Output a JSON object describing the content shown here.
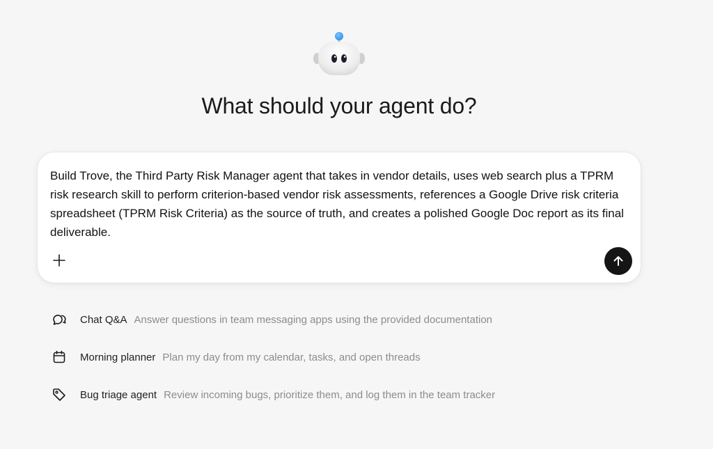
{
  "heading": "What should your agent do?",
  "composer": {
    "prompt": "Build Trove, the Third Party Risk Manager agent that takes in vendor details, uses web search plus a TPRM risk research skill to perform criterion-based vendor risk assessments, references a Google Drive risk criteria spreadsheet (TPRM Risk Criteria) as the source of truth, and creates a polished Google Doc report as its final deliverable.",
    "attach_icon": "plus-icon",
    "send_icon": "arrow-up-icon"
  },
  "suggestions": [
    {
      "icon": "chat-bubbles-icon",
      "title": "Chat Q&A",
      "description": "Answer questions in team messaging apps using the provided documentation"
    },
    {
      "icon": "calendar-icon",
      "title": "Morning planner",
      "description": "Plan my day from my calendar, tasks, and open threads"
    },
    {
      "icon": "tag-icon",
      "title": "Bug triage agent",
      "description": "Review incoming bugs, prioritize them, and log them in the team tracker"
    }
  ],
  "colors": {
    "background": "#f6f6f6",
    "send_button": "#151515",
    "mascot_antenna": "#3b9cf0",
    "description_text": "#8c8c8c"
  }
}
